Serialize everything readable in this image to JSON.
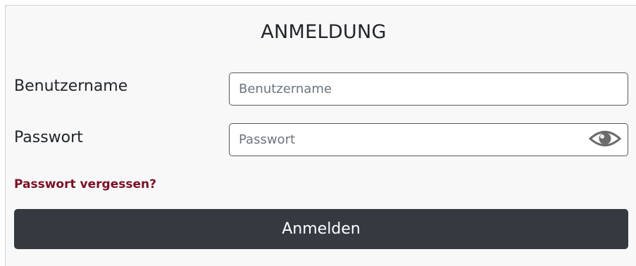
{
  "form": {
    "title": "ANMELDUNG",
    "username": {
      "label": "Benutzername",
      "placeholder": "Benutzername",
      "value": ""
    },
    "password": {
      "label": "Passwort",
      "placeholder": "Passwort",
      "value": "",
      "toggle_icon": "eye-icon"
    },
    "forgot_link": "Passwort vergessen?",
    "submit_label": "Anmelden"
  },
  "colors": {
    "background": "#f8f8f8",
    "button_bg": "#343a40",
    "button_text": "#ffffff",
    "link": "#7a0f24",
    "input_border": "#555b61"
  }
}
